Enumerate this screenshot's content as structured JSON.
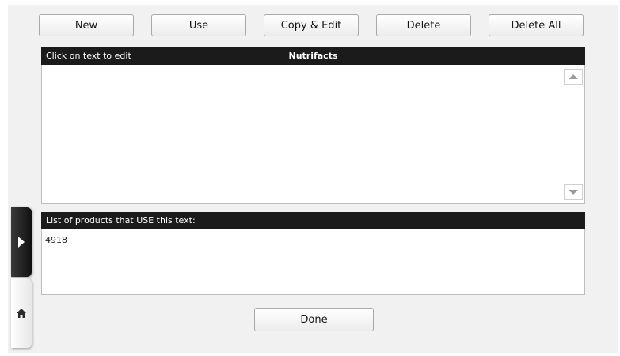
{
  "toolbar": {
    "buttons": [
      "New",
      "Use",
      "Copy & Edit",
      "Delete",
      "Delete All"
    ]
  },
  "text_panel": {
    "hint": "Click on text to edit",
    "title": "Nutrifacts"
  },
  "products_panel": {
    "header": "List of products that USE this text:",
    "items": [
      "4918"
    ]
  },
  "footer": {
    "done_label": "Done"
  },
  "side_tabs": {
    "expand_icon": "play-arrow-icon",
    "home_icon": "home-icon"
  }
}
